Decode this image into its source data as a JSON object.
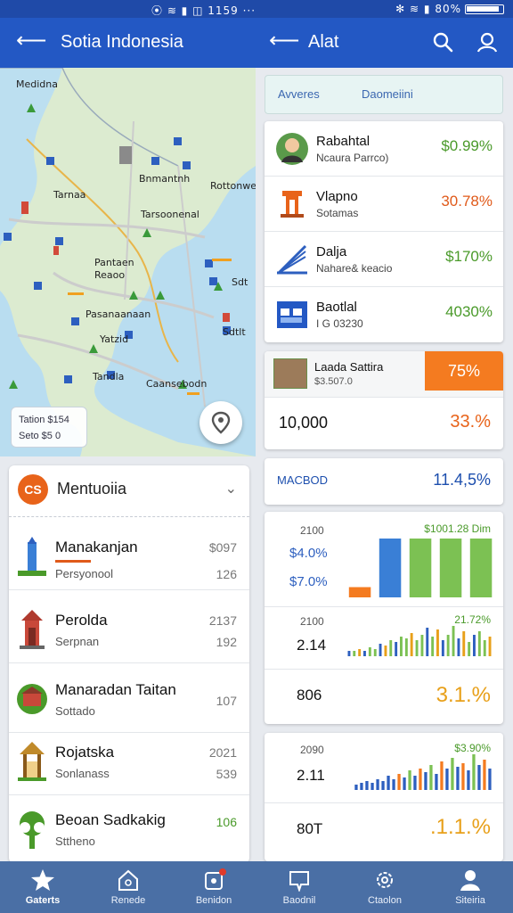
{
  "status_bar": {
    "left_text": "⦿ ≋ ▮ ◫ 1159 ···",
    "right_text": "✻ ≋ ▮ 80%"
  },
  "left_header": {
    "title": "Sotia Indonesia"
  },
  "right_header": {
    "title": "Alat"
  },
  "map": {
    "labels": [
      "Medidna",
      "Bnmantnh",
      "Tarnaa",
      "Rottonwee",
      "Tarsoonenal",
      "Pantaen",
      "Reaoo",
      "Sdt",
      "Pasanaanaan",
      "Yatzid",
      "Tandla",
      "Caansebodn",
      "Sdtlt"
    ],
    "info_line1": "Tation $154",
    "info_line2": "Seto $5 0"
  },
  "attractions": {
    "badge": "CS",
    "title": "Mentuoiia",
    "items": [
      {
        "name": "Manakanjan",
        "sub": "Persyonool",
        "v1": "$097",
        "v2": "126"
      },
      {
        "name": "Perolda",
        "sub": "Serpnan",
        "v1": "2137",
        "v2": "192"
      },
      {
        "name": "Manaradan Taitan",
        "sub": "Sottado",
        "v1": "107",
        "v2": ""
      },
      {
        "name": "Rojatska",
        "sub": "Sonlanass",
        "v1": "2021",
        "v2": "539"
      },
      {
        "name": "Beoan Sadkakig",
        "sub": "Sttheno",
        "v1": "106",
        "v2": ""
      }
    ]
  },
  "tabs": [
    "Avveres",
    "Daomeiini"
  ],
  "stocks": [
    {
      "name": "Rabahtal",
      "sub": "Ncaura Parrco)",
      "pct": "$0.99%",
      "color": "#4a9a2a"
    },
    {
      "name": "Vlapno",
      "sub": "Sotamas",
      "pct": "30.78%",
      "color": "#e05a1a"
    },
    {
      "name": "Dalja",
      "sub": "Nahare& keacio",
      "pct": "$170%",
      "color": "#4a9a2a"
    },
    {
      "name": "Baotlal",
      "sub": "I G 03230",
      "pct": "4030%",
      "color": "#4a9a2a"
    }
  ],
  "featured": {
    "name": "Laada Sattira",
    "sub": "$3.507.0",
    "pct": "75%",
    "big": "10,000",
    "bigpct": "33.%"
  },
  "macro": {
    "label": "MACBOD",
    "value": "11.4,5%"
  },
  "chart1": {
    "top_small": "2100",
    "y1": "$4.0%",
    "y2": "$7.0%",
    "top_right": "$1001.28 Dim",
    "mid_small": "2100",
    "mid_num": "2.14",
    "mid_right": "21.72%",
    "bottom_num": "806",
    "bottom_pct": "3.1.%"
  },
  "chart2": {
    "top_small": "2090",
    "top_right": "$3.90%",
    "mid_num": "2.11",
    "bottom_num": "80T",
    "bottom_pct": ".1.1.%"
  },
  "chart_data": [
    {
      "type": "bar",
      "values": [
        8,
        46,
        46,
        46,
        46
      ],
      "colors": [
        "#f47b20",
        "#3a7fd6",
        "#7cc153",
        "#7cc153",
        "#7cc153"
      ]
    },
    {
      "type": "bar",
      "values": [
        3,
        3,
        4,
        3,
        5,
        4,
        7,
        6,
        9,
        8,
        11,
        10,
        13,
        9,
        12,
        16,
        11,
        15,
        9,
        12,
        17,
        10,
        14,
        8,
        12,
        14,
        9,
        11
      ]
    },
    {
      "type": "bar",
      "values": [
        3,
        4,
        5,
        4,
        6,
        5,
        8,
        6,
        9,
        7,
        11,
        8,
        12,
        10,
        14,
        9,
        16,
        12,
        18,
        13,
        15,
        11,
        20,
        14,
        17,
        12
      ]
    }
  ],
  "bottom_nav": [
    {
      "label": "Gaterts",
      "icon": "star-icon",
      "active": true
    },
    {
      "label": "Renede",
      "icon": "home-icon",
      "active": false
    },
    {
      "label": "Benidon",
      "icon": "badge-icon",
      "active": false
    },
    {
      "label": "Baodnil",
      "icon": "chat-icon",
      "active": false
    },
    {
      "label": "Ctaolon",
      "icon": "gear-icon",
      "active": false
    },
    {
      "label": "Siteiria",
      "icon": "user-icon",
      "active": false
    }
  ]
}
